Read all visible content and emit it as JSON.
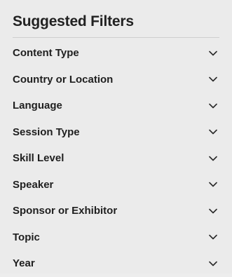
{
  "panel": {
    "title": "Suggested Filters",
    "filters": [
      {
        "label": "Content Type",
        "icon": "chevron-down-icon"
      },
      {
        "label": "Country or Location",
        "icon": "chevron-down-icon"
      },
      {
        "label": "Language",
        "icon": "chevron-down-icon"
      },
      {
        "label": "Session Type",
        "icon": "chevron-down-icon"
      },
      {
        "label": "Skill Level",
        "icon": "chevron-down-icon"
      },
      {
        "label": "Speaker",
        "icon": "chevron-down-icon"
      },
      {
        "label": "Sponsor or Exhibitor",
        "icon": "chevron-down-icon"
      },
      {
        "label": "Topic",
        "icon": "chevron-down-icon"
      },
      {
        "label": "Year",
        "icon": "chevron-down-icon"
      }
    ]
  },
  "colors": {
    "background": "#ebebeb",
    "text": "#1f1f1f",
    "divider": "#cfcfcf"
  }
}
